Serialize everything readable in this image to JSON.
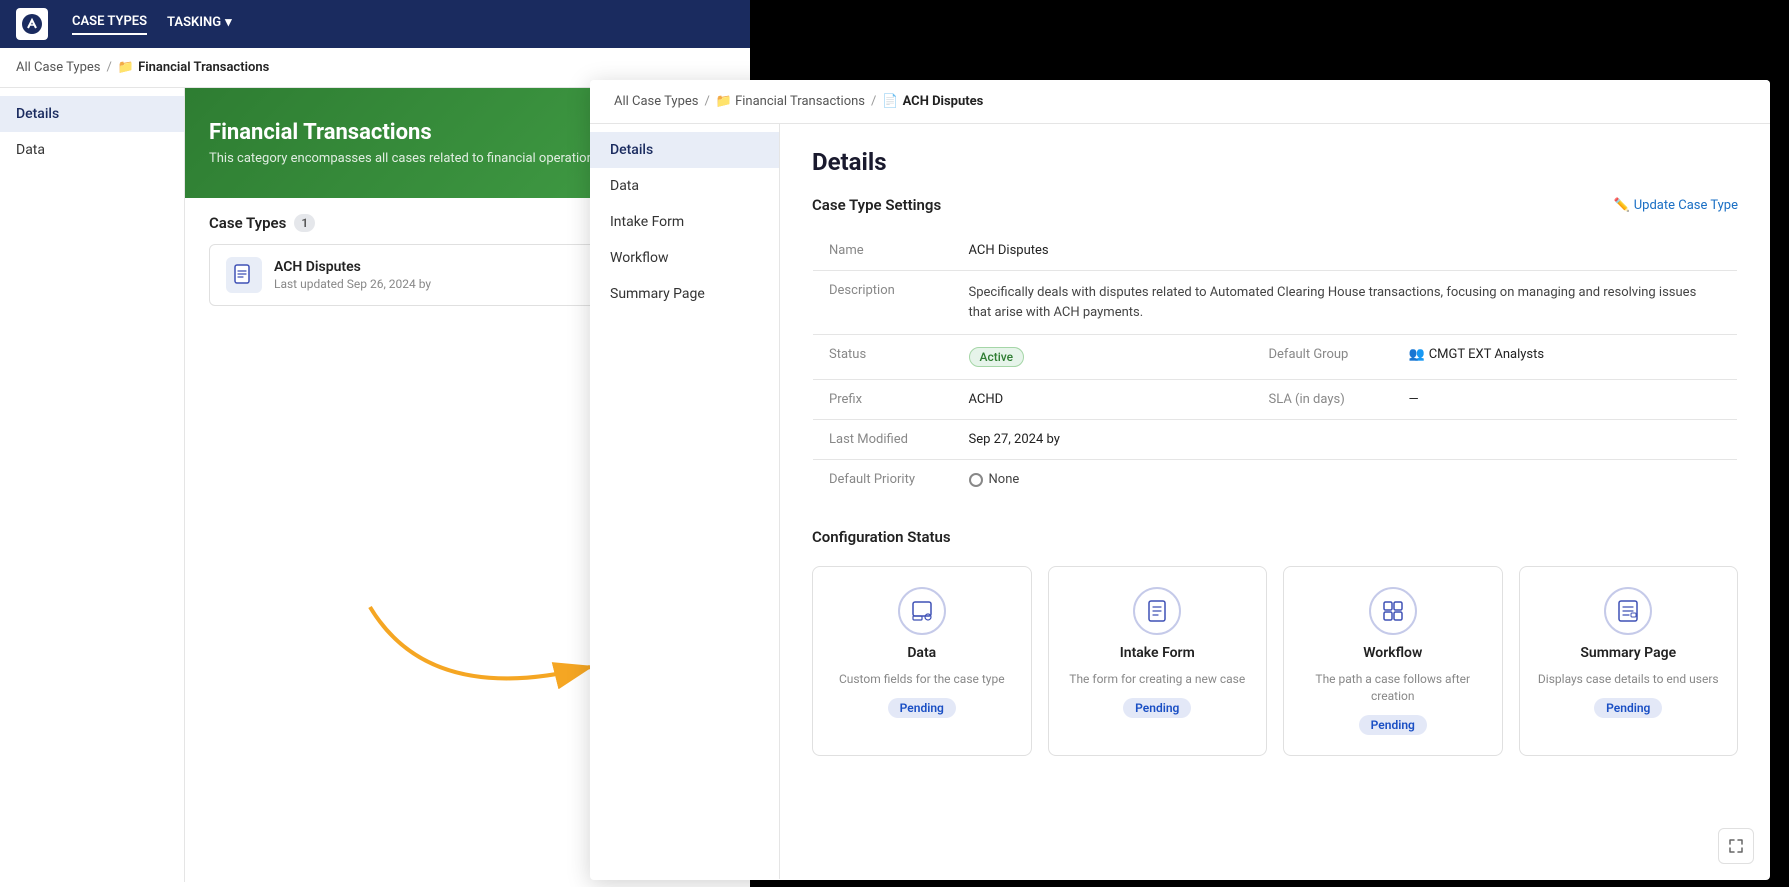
{
  "app": {
    "logo": "A",
    "nav": {
      "casetypes_label": "CASE TYPES",
      "tasking_label": "TASKING"
    }
  },
  "left_panel": {
    "breadcrumb": {
      "all_case_types": "All Case Types",
      "sep1": "/",
      "folder_icon": "📁",
      "current": "Financial Transactions"
    },
    "sidebar": {
      "items": [
        {
          "label": "Details",
          "active": true
        },
        {
          "label": "Data",
          "active": false
        }
      ]
    },
    "banner": {
      "title": "Financial Transactions",
      "description": "This category encompasses all cases related to financial operations"
    },
    "case_types": {
      "label": "Case Types",
      "count": "1",
      "items": [
        {
          "name": "ACH Disputes",
          "meta": "Last updated Sep 26, 2024 by"
        }
      ]
    }
  },
  "right_panel": {
    "breadcrumb": {
      "all_case_types": "All Case Types",
      "sep1": "/",
      "folder_icon": "📁",
      "financial_transactions": "Financial Transactions",
      "sep2": "/",
      "doc_icon": "📄",
      "current": "ACH Disputes"
    },
    "sidebar": {
      "items": [
        {
          "label": "Details",
          "active": true
        },
        {
          "label": "Data",
          "active": false
        },
        {
          "label": "Intake Form",
          "active": false
        },
        {
          "label": "Workflow",
          "active": false
        },
        {
          "label": "Summary Page",
          "active": false
        }
      ]
    },
    "main": {
      "page_title": "Details",
      "case_type_settings_label": "Case Type Settings",
      "update_link_label": "Update Case Type",
      "fields": {
        "name_label": "Name",
        "name_value": "ACH Disputes",
        "description_label": "Description",
        "description_value": "Specifically deals with disputes related to Automated Clearing House transactions, focusing on managing and resolving issues that arise with ACH payments.",
        "status_label": "Status",
        "status_value": "Active",
        "default_group_label": "Default Group",
        "default_group_value": "CMGT EXT Analysts",
        "prefix_label": "Prefix",
        "prefix_value": "ACHD",
        "sla_label": "SLA (in days)",
        "sla_value": "—",
        "last_modified_label": "Last Modified",
        "last_modified_value": "Sep 27, 2024 by",
        "default_priority_label": "Default Priority",
        "default_priority_value": "None"
      },
      "configuration_status_label": "Configuration Status",
      "config_cards": [
        {
          "title": "Data",
          "description": "Custom fields for the case type",
          "status": "Pending",
          "icon": "data-icon"
        },
        {
          "title": "Intake Form",
          "description": "The form for creating a new case",
          "status": "Pending",
          "icon": "form-icon"
        },
        {
          "title": "Workflow",
          "description": "The path a case follows after creation",
          "status": "Pending",
          "icon": "workflow-icon"
        },
        {
          "title": "Summary Page",
          "description": "Displays case details to end users",
          "status": "Pending",
          "icon": "summary-icon"
        }
      ]
    }
  },
  "arrow": {
    "color": "#f5a623"
  }
}
